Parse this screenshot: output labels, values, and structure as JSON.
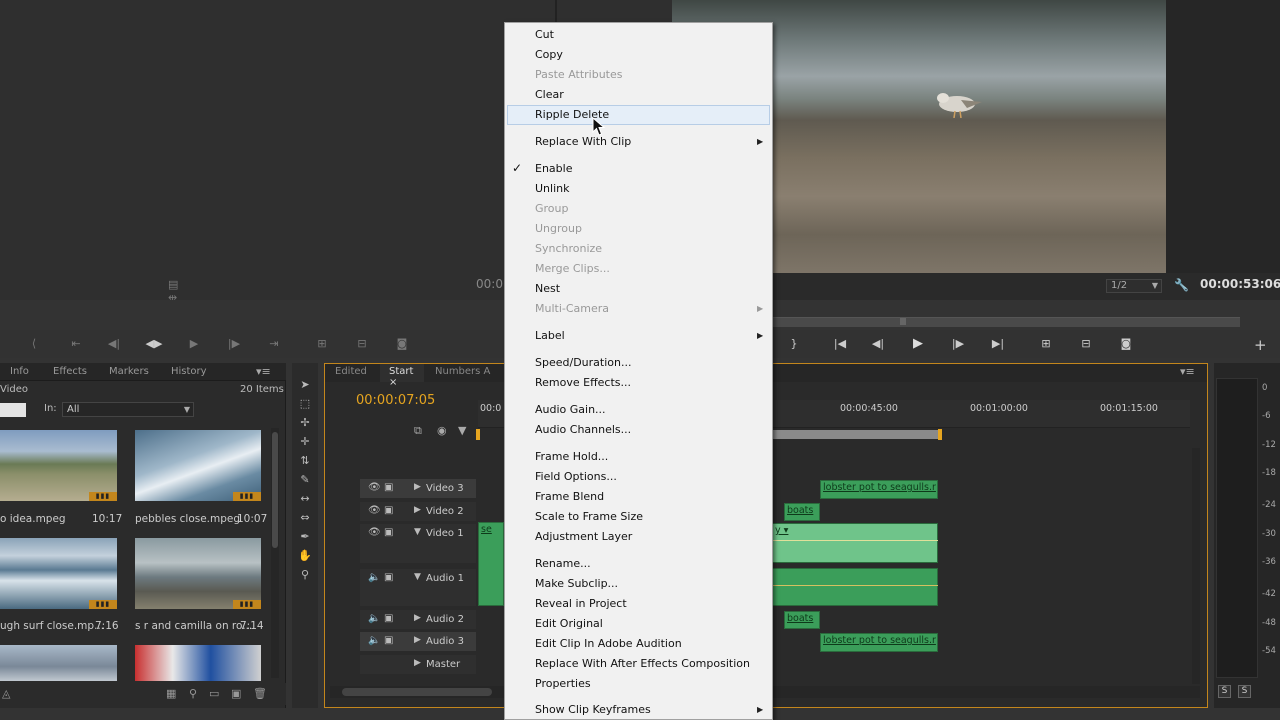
{
  "source_monitor": {
    "timecode": "00:0",
    "icons": [
      "list-icon",
      "adjust-icon"
    ]
  },
  "program_monitor": {
    "zoom": "1/2",
    "timecode": "00:00:53:06"
  },
  "project_panel": {
    "tabs": [
      "Info",
      "Effects",
      "Markers",
      "History"
    ],
    "bin_name": "Video",
    "item_count": "20 Items",
    "in_label": "In:",
    "in_value": "All",
    "clips": [
      {
        "name": "o idea.mpeg",
        "duration": "10:17"
      },
      {
        "name": "pebbles close.mpeg",
        "duration": "10:07"
      },
      {
        "name": "ugh surf close.mp...",
        "duration": "7:16"
      },
      {
        "name": "s r and camilla on ro...",
        "duration": "7:14"
      }
    ],
    "badge_text": "▮▮▮"
  },
  "timeline": {
    "tabs": [
      "Edited",
      "Start",
      "Numbers A"
    ],
    "timecode": "00:00:07:05",
    "ruler": [
      "00:0",
      "00:00:45:00",
      "00:01:00:00",
      "00:01:15:00"
    ],
    "tracks": [
      "Video 3",
      "Video 2",
      "Video 1",
      "Audio 1",
      "Audio 2",
      "Audio 3",
      "Master"
    ],
    "clip_labels": {
      "video3": "lobster pot to seagulls.r",
      "video2": "boats",
      "audio2": "boats",
      "audio3": "lobster pot to seagulls.r",
      "v1_fx": "y ▾",
      "small_a": "se",
      "small_b": "se"
    }
  },
  "audio_meters": {
    "labels": [
      "0",
      "-6",
      "-12",
      "-18",
      "-24",
      "-30",
      "-36",
      "-42",
      "-48",
      "-54"
    ],
    "solo": "S"
  },
  "context_menu": {
    "items": [
      {
        "label": "Cut",
        "enabled": true
      },
      {
        "label": "Copy",
        "enabled": true
      },
      {
        "label": "Paste Attributes",
        "enabled": false
      },
      {
        "label": "Clear",
        "enabled": true
      },
      {
        "label": "Ripple Delete",
        "enabled": true,
        "highlighted": true
      },
      {
        "label": "Replace With Clip",
        "enabled": true,
        "submenu": true
      },
      {
        "label": "Enable",
        "enabled": true,
        "checked": true
      },
      {
        "label": "Unlink",
        "enabled": true
      },
      {
        "label": "Group",
        "enabled": false
      },
      {
        "label": "Ungroup",
        "enabled": false
      },
      {
        "label": "Synchronize",
        "enabled": false
      },
      {
        "label": "Merge Clips...",
        "enabled": false
      },
      {
        "label": "Nest",
        "enabled": true
      },
      {
        "label": "Multi-Camera",
        "enabled": false,
        "submenu": true
      },
      {
        "label": "Label",
        "enabled": true,
        "submenu": true
      },
      {
        "label": "Speed/Duration...",
        "enabled": true
      },
      {
        "label": "Remove Effects...",
        "enabled": true
      },
      {
        "label": "Audio Gain...",
        "enabled": true
      },
      {
        "label": "Audio Channels...",
        "enabled": true
      },
      {
        "label": "Frame Hold...",
        "enabled": true
      },
      {
        "label": "Field Options...",
        "enabled": true
      },
      {
        "label": "Frame Blend",
        "enabled": true
      },
      {
        "label": "Scale to Frame Size",
        "enabled": true
      },
      {
        "label": "Adjustment Layer",
        "enabled": true
      },
      {
        "label": "Rename...",
        "enabled": true
      },
      {
        "label": "Make Subclip...",
        "enabled": true
      },
      {
        "label": "Reveal in Project",
        "enabled": true
      },
      {
        "label": "Edit Original",
        "enabled": true
      },
      {
        "label": "Edit Clip In Adobe Audition",
        "enabled": true
      },
      {
        "label": "Replace With After Effects Composition",
        "enabled": true
      },
      {
        "label": "Properties",
        "enabled": true
      },
      {
        "label": "Show Clip Keyframes",
        "enabled": true,
        "submenu": true
      }
    ]
  },
  "colors": {
    "accent_orange": "#e6a520",
    "clip_green": "#3b9e5a",
    "menu_bg": "#f1f1f1"
  }
}
